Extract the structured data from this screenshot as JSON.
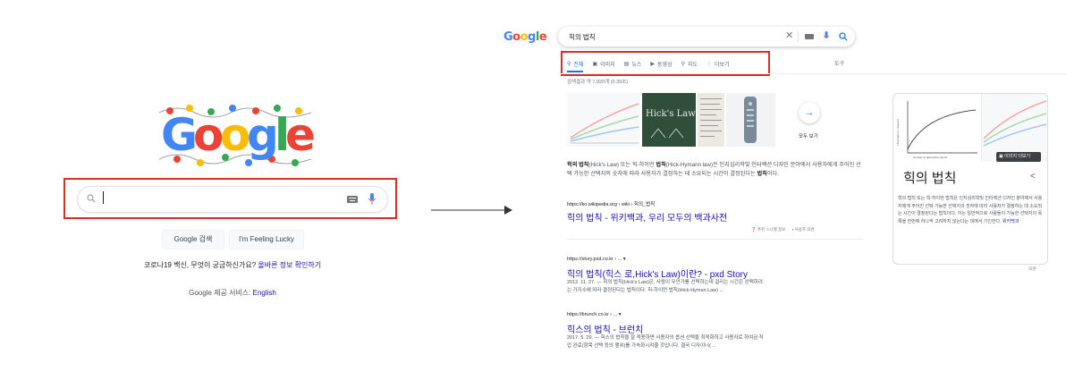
{
  "home": {
    "logo_text": "Google",
    "search_value": "",
    "buttons": {
      "search": "Google 검색",
      "lucky": "I'm Feeling Lucky"
    },
    "promo": {
      "prefix": "코로나19 백신, 무엇이 궁금하신가요?",
      "link": "올바른 정보 확인하기"
    },
    "offered": {
      "prefix": "Google 제공 서비스:",
      "link": "English"
    }
  },
  "results": {
    "logo_text": "Google",
    "query": "힉의 법칙",
    "tabs": [
      {
        "label": "전체",
        "icon": "search-icon"
      },
      {
        "label": "이미지",
        "icon": "image-icon"
      },
      {
        "label": "뉴스",
        "icon": "news-icon"
      },
      {
        "label": "동영상",
        "icon": "video-icon"
      },
      {
        "label": "지도",
        "icon": "map-pin-icon"
      },
      {
        "label": "더보기",
        "icon": "more-icon"
      }
    ],
    "tools": "도구",
    "count": "검색결과 약 7,820개 (0.39초)",
    "image_strip": {
      "hicks_law_text": "Hick's Law",
      "see_all": "모두 보기"
    },
    "featured": {
      "snippet_bold1": "힉의 법칙",
      "snippet_a": "(Hick's Law) 또는 힉-하이먼 ",
      "snippet_bold2": "법칙",
      "snippet_b": "(Hick-Hymann law)은 인지심리학및 인터랙션 디자인 분야에서 사용자에게 주어진 선택 가능한 선택지의 숫자에 따라 사용자가 결정하는 데 소요되는 시간이 결정된다는 ",
      "snippet_bold3": "법칙",
      "snippet_c": "이다.",
      "url": "https://ko.wikipedia.org › wiki › 힉의_법칙",
      "title": "힉의 법칙 - 위키백과, 우리 모두의 백과사전",
      "feedback_snippets": "추천 스니펫 정보",
      "feedback_opinion": "사용자 의견"
    },
    "items": [
      {
        "url": "https://story.pxd.co.kr › ...",
        "title": "힉의 법칙(힉스 로,Hick's Law)이란? - pxd Story",
        "desc1": "2012. 11. 27. — 힉의 법칙(Hick's Law)은, 사람이 무언가를 선택하는데 걸리는 시간은 선택하려",
        "desc2": "는 가지수에 따라 결정된다는 법칙이다. 힉-하이먼 법칙(Hick-Hyman Law) ..."
      },
      {
        "url": "https://brunch.co.kr › ...",
        "title": "힉스의 법칙 - 브런치",
        "desc1": "2017. 5. 29. — 힉스의 법칙을 잘 적용하면 사용자의 옵션 선택을 최적화하고 사용자로 하여금 작",
        "desc2": "업 완료(항목 선택 등의 행위)를 가속화시켜줄 것입니다. 결국 디자이너( ..."
      }
    ],
    "knowledge_panel": {
      "title": "힉의 법칙",
      "more_images": "이미지 더보기",
      "chart_ylabel": "Time taken to respond",
      "chart_xlabel": "Number of alternative stimuli",
      "desc": "힉의 법칙 또는 힉-하이먼 법칙은 인지심리학및 인터랙션 디자인 분야에서 사용자에게 주어진 선택 가능한 선택지의 숫자에 따라 사용자가 결정하는 데 소요되는 시간이 결정된다는 법칙이다. 이는 일반적으로 사람들이 가능한 선택지의 목록을 한번에 하나씩 고려하지 않는다는 데에서 기인한다.",
      "source": "위키백과",
      "feedback": "의견"
    }
  },
  "colors": {
    "blue": "#4285f4",
    "red": "#ea4335",
    "yellow": "#fbbc05",
    "green": "#34a853",
    "highlight": "#d93025",
    "link": "#1a0dab"
  }
}
